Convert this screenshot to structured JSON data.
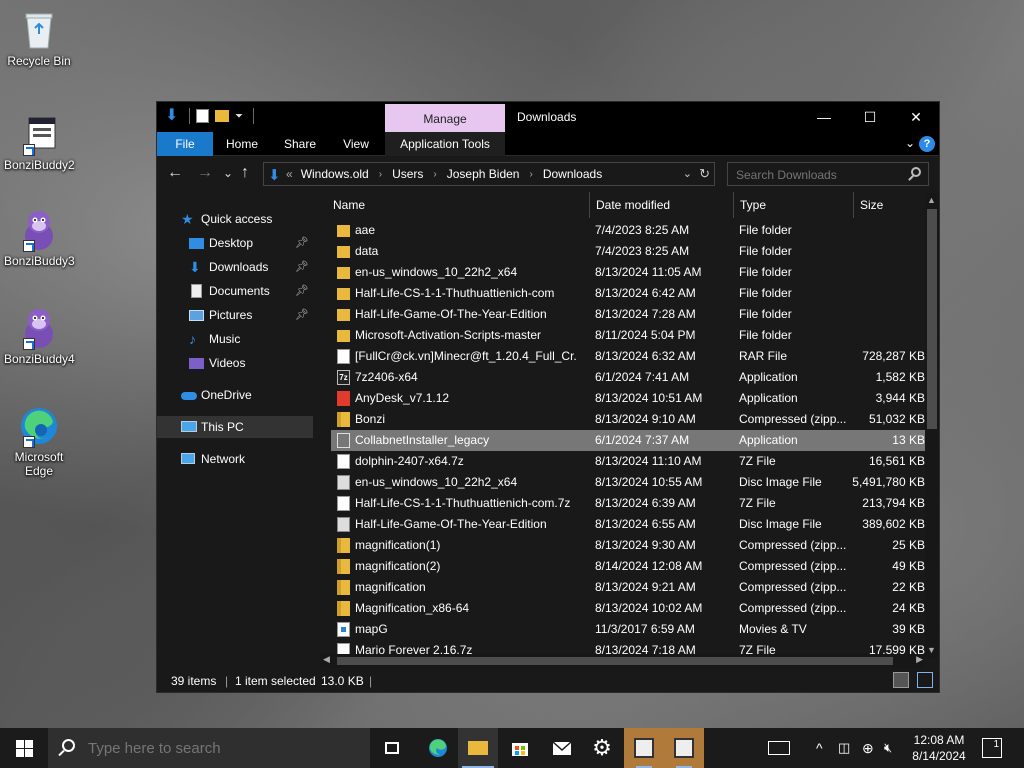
{
  "desktop": {
    "icons": [
      {
        "label": "Recycle Bin"
      },
      {
        "label": "BonziBuddy2"
      },
      {
        "label": "BonziBuddy3"
      },
      {
        "label": "BonziBuddy4"
      },
      {
        "label": "Microsoft Edge"
      }
    ]
  },
  "window": {
    "title": "Downloads",
    "manage_tab": "Manage",
    "controls": {
      "minimize": "—",
      "maximize": "☐",
      "close": "✕"
    },
    "ribbon": {
      "file": "File",
      "home": "Home",
      "share": "Share",
      "view": "View",
      "app_tools": "Application Tools",
      "expand": "⌄",
      "help": "?"
    },
    "nav": {
      "back": "←",
      "forward": "→",
      "recent": "⌄",
      "up": "↑"
    },
    "address": {
      "prefix": "«",
      "crumbs": [
        "Windows.old",
        "Users",
        "Joseph Biden",
        "Downloads"
      ],
      "separator": "›"
    },
    "search": {
      "placeholder": "Search Downloads"
    },
    "navpane": [
      {
        "label": "Quick access",
        "icon": "star-icon",
        "pinned": false
      },
      {
        "label": "Desktop",
        "icon": "desktop-icon",
        "pinned": true
      },
      {
        "label": "Downloads",
        "icon": "download-icon",
        "pinned": true
      },
      {
        "label": "Documents",
        "icon": "documents-icon",
        "pinned": true
      },
      {
        "label": "Pictures",
        "icon": "pictures-icon",
        "pinned": true
      },
      {
        "label": "Music",
        "icon": "music-icon",
        "pinned": false
      },
      {
        "label": "Videos",
        "icon": "videos-icon",
        "pinned": false
      },
      {
        "label": "OneDrive",
        "icon": "cloud-icon",
        "pinned": false
      },
      {
        "label": "This PC",
        "icon": "computer-icon",
        "pinned": false,
        "selected": true
      },
      {
        "label": "Network",
        "icon": "network-icon",
        "pinned": false
      }
    ],
    "columns": {
      "name": "Name",
      "date": "Date modified",
      "type": "Type",
      "size": "Size"
    },
    "files": [
      {
        "name": "aae",
        "date": "7/4/2023 8:25 AM",
        "type": "File folder",
        "size": "",
        "icon": "folder"
      },
      {
        "name": "data",
        "date": "7/4/2023 8:25 AM",
        "type": "File folder",
        "size": "",
        "icon": "folder"
      },
      {
        "name": "en-us_windows_10_22h2_x64",
        "date": "8/13/2024 11:05 AM",
        "type": "File folder",
        "size": "",
        "icon": "folder"
      },
      {
        "name": "Half-Life-CS-1-1-Thuthuattienich-com",
        "date": "8/13/2024 6:42 AM",
        "type": "File folder",
        "size": "",
        "icon": "folder"
      },
      {
        "name": "Half-Life-Game-Of-The-Year-Edition",
        "date": "8/13/2024 7:28 AM",
        "type": "File folder",
        "size": "",
        "icon": "folder"
      },
      {
        "name": "Microsoft-Activation-Scripts-master",
        "date": "8/11/2024 5:04 PM",
        "type": "File folder",
        "size": "",
        "icon": "folder"
      },
      {
        "name": "[FullCr@ck.vn]Minecr@ft_1.20.4_Full_Cr...",
        "date": "8/13/2024 6:32 AM",
        "type": "RAR File",
        "size": "728,287 KB",
        "icon": "doc"
      },
      {
        "name": "7z2406-x64",
        "date": "6/1/2024 7:41 AM",
        "type": "Application",
        "size": "1,582 KB",
        "icon": "app7"
      },
      {
        "name": "AnyDesk_v7.1.12",
        "date": "8/13/2024 10:51 AM",
        "type": "Application",
        "size": "3,944 KB",
        "icon": "anydesk"
      },
      {
        "name": "Bonzi",
        "date": "8/13/2024 9:10 AM",
        "type": "Compressed (zipp...",
        "size": "51,032 KB",
        "icon": "zip"
      },
      {
        "name": "CollabnetInstaller_legacy",
        "date": "6/1/2024 7:37 AM",
        "type": "Application",
        "size": "13 KB",
        "icon": "setup",
        "selected": true
      },
      {
        "name": "dolphin-2407-x64.7z",
        "date": "8/13/2024 11:10 AM",
        "type": "7Z File",
        "size": "16,561 KB",
        "icon": "doc"
      },
      {
        "name": "en-us_windows_10_22h2_x64",
        "date": "8/13/2024 10:55 AM",
        "type": "Disc Image File",
        "size": "5,491,780 KB",
        "icon": "disc"
      },
      {
        "name": "Half-Life-CS-1-1-Thuthuattienich-com.7z",
        "date": "8/13/2024 6:39 AM",
        "type": "7Z File",
        "size": "213,794 KB",
        "icon": "doc"
      },
      {
        "name": "Half-Life-Game-Of-The-Year-Edition",
        "date": "8/13/2024 6:55 AM",
        "type": "Disc Image File",
        "size": "389,602 KB",
        "icon": "disc"
      },
      {
        "name": "magnification(1)",
        "date": "8/13/2024 9:30 AM",
        "type": "Compressed (zipp...",
        "size": "25 KB",
        "icon": "zip"
      },
      {
        "name": "magnification(2)",
        "date": "8/14/2024 12:08 AM",
        "type": "Compressed (zipp...",
        "size": "49 KB",
        "icon": "zip"
      },
      {
        "name": "magnification",
        "date": "8/13/2024 9:21 AM",
        "type": "Compressed (zipp...",
        "size": "22 KB",
        "icon": "zip"
      },
      {
        "name": "Magnification_x86-64",
        "date": "8/13/2024 10:02 AM",
        "type": "Compressed (zipp...",
        "size": "24 KB",
        "icon": "zip"
      },
      {
        "name": "mapG",
        "date": "11/3/2017 6:59 AM",
        "type": "Movies & TV",
        "size": "39 KB",
        "icon": "movie"
      },
      {
        "name": "Mario Forever 2.16.7z",
        "date": "8/13/2024 7:18 AM",
        "type": "7Z File",
        "size": "17,599 KB",
        "icon": "doc"
      }
    ],
    "status": {
      "items": "39 items",
      "selected": "1 item selected",
      "size": "13.0 KB",
      "sep": "|"
    }
  },
  "taskbar": {
    "search_placeholder": "Type here to search",
    "clock": {
      "time": "12:08 AM",
      "date": "8/14/2024"
    },
    "notifications": "1"
  },
  "colors": {
    "accent": "#1979ca",
    "manage": "#e7c6f0",
    "folder": "#e8b93c"
  }
}
